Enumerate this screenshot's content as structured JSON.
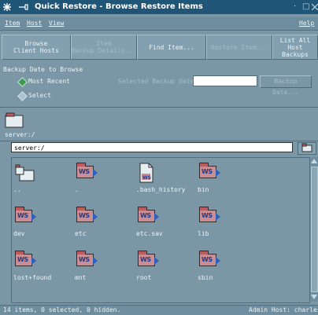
{
  "window": {
    "title": "Quick Restore - Browse Restore Items",
    "minimize_glyph": "·",
    "maximize_glyph": "□"
  },
  "menu": {
    "item": "Item",
    "host": "Host",
    "view": "View",
    "help": "Help"
  },
  "toolbar": {
    "browse_client_hosts": "Browse\nClient Hosts",
    "item_backup_details": "Item\nBackup Details...",
    "find_item": "Find Item...",
    "restore_item": "Restore Item...",
    "list_all_host_backups": "List All\nHost Backups"
  },
  "backup": {
    "section_label": "Backup Date to Browse",
    "most_recent": "Most Recent",
    "select": "Select",
    "selected_backup_date_label": "Selected Backup Date:",
    "selected_backup_date_value": "",
    "backup_date_button": "Backup Date..."
  },
  "host": {
    "label": "server:/"
  },
  "path": {
    "value": "server:/"
  },
  "items": [
    {
      "name": "..",
      "type": "folder"
    },
    {
      "name": ".",
      "type": "ws"
    },
    {
      "name": ".bash_history",
      "type": "file"
    },
    {
      "name": "bin",
      "type": "ws"
    },
    {
      "name": "dev",
      "type": "ws"
    },
    {
      "name": "etc",
      "type": "ws"
    },
    {
      "name": "etc.sav",
      "type": "ws"
    },
    {
      "name": "lib",
      "type": "ws"
    },
    {
      "name": "lost+found",
      "type": "ws"
    },
    {
      "name": "mnt",
      "type": "ws"
    },
    {
      "name": "root",
      "type": "ws"
    },
    {
      "name": "sbin",
      "type": "ws"
    }
  ],
  "ws_badge": "WS",
  "status": {
    "left": "14 items, 0 selected, 0 hidden.",
    "right": "Admin Host: charlesc"
  }
}
